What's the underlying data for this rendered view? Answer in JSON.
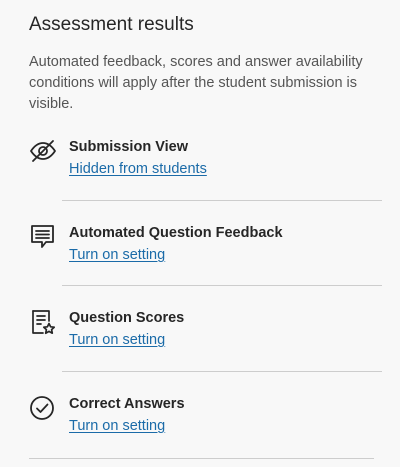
{
  "header": {
    "title": "Assessment results",
    "description": "Automated feedback, scores and answer availability conditions will apply after the student submission is visible."
  },
  "settings": [
    {
      "icon": "eye-slash-icon",
      "name": "Submission View",
      "link": "Hidden from students"
    },
    {
      "icon": "feedback-message-icon",
      "name": "Automated Question Feedback",
      "link": "Turn on setting"
    },
    {
      "icon": "score-document-icon",
      "name": "Question Scores",
      "link": "Turn on setting"
    },
    {
      "icon": "check-circle-icon",
      "name": "Correct Answers",
      "link": "Turn on setting"
    }
  ],
  "colors": {
    "link": "#1b6ba8",
    "text": "#262626",
    "muted_text": "#555555",
    "divider": "#cdcdcd",
    "background": "#f8f8f8"
  }
}
